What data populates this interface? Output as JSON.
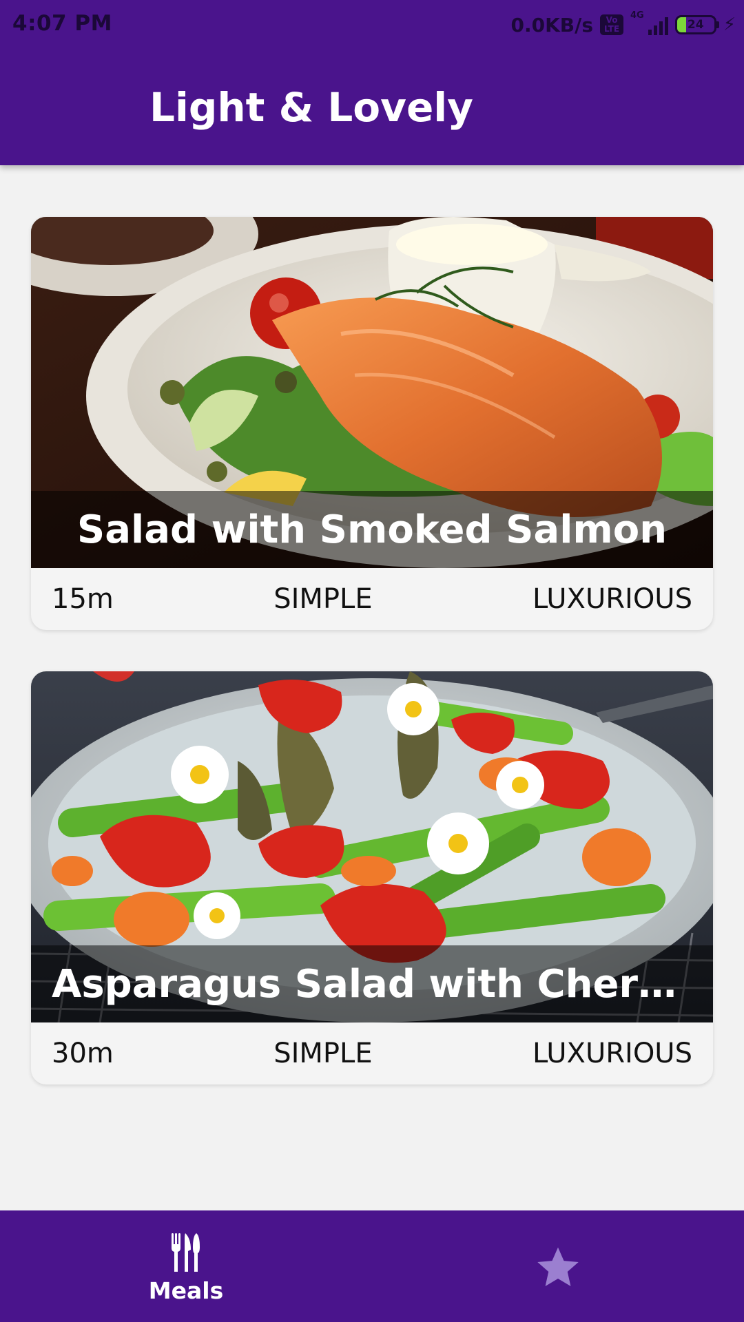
{
  "status_bar": {
    "time": "4:07 PM",
    "network_speed": "0.0KB/s",
    "volte_label": "Vo LTE",
    "network_type": "4G",
    "battery_level": "24",
    "battery_fraction": 0.24
  },
  "header": {
    "title": "Light & Lovely"
  },
  "meals": [
    {
      "title": "Salad with Smoked Salmon",
      "duration": "15m",
      "complexity": "SIMPLE",
      "affordability": "LUXURIOUS",
      "image": "smoked-salmon-salad-photo"
    },
    {
      "title": "Asparagus Salad with Cherry...",
      "duration": "30m",
      "complexity": "SIMPLE",
      "affordability": "LUXURIOUS",
      "image": "asparagus-strawberry-salad-photo"
    }
  ],
  "bottom_nav": {
    "tabs": [
      {
        "label": "Meals",
        "icon": "cutlery-icon",
        "active": true
      },
      {
        "label": "",
        "icon": "star-icon",
        "active": false
      }
    ]
  },
  "colors": {
    "primary": "#4a148c",
    "inactive_icon": "#9b7fd0",
    "background": "#f2f2f2"
  }
}
